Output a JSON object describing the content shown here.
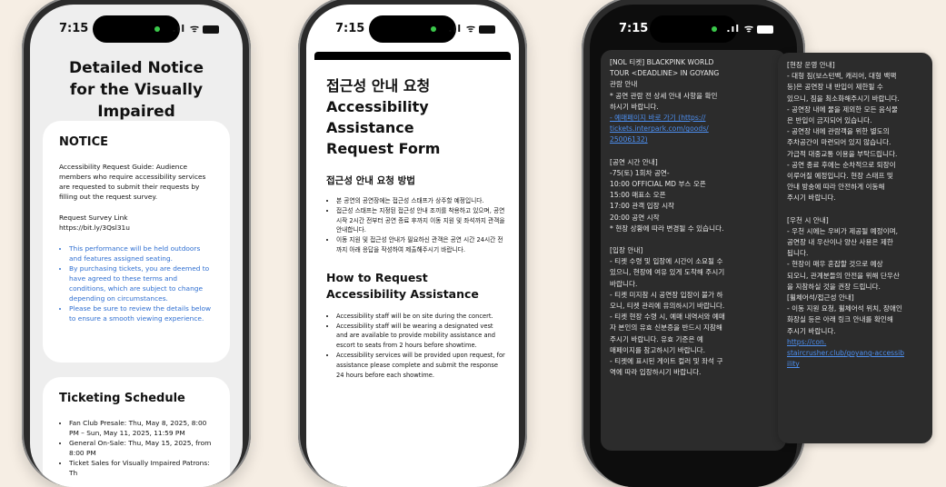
{
  "status": {
    "time": "7:15",
    "signal": ".ıl",
    "wifi": "ᯤ"
  },
  "phone1": {
    "title_line1": "Detailed Notice",
    "title_line2": "for the Visually Impaired",
    "notice": {
      "heading": "NOTICE",
      "body": "Accessibility Request Guide: Audience members who require accessibility services are requested to submit their requests by filling out the request survey.",
      "link_label": "Request Survey Link",
      "link_url": "https://bit.ly/3Qsl31u",
      "bullets": [
        "This performance will be held outdoors and features assigned seating.",
        "By purchasing tickets, you are deemed to have agreed to these terms and conditions, which are subject to change depending on circumstances.",
        "Please be sure to review the details below to ensure a smooth viewing experience."
      ]
    },
    "schedule": {
      "heading": "Ticketing Schedule",
      "bullets": [
        "Fan Club Presale: Thu, May 8, 2025, 8:00 PM – Sun, May 11, 2025, 11:59 PM",
        "General On-Sale: Thu, May 15, 2025, from 8:00 PM",
        "Ticket Sales for Visually Impaired Patrons: Th"
      ]
    }
  },
  "phone2": {
    "title_kr": "접근성 안내 요청",
    "title_en_1": "Accessibility Assistance",
    "title_en_2": "Request Form",
    "section_kr": "접근성 안내 요청 방법",
    "bullets_kr": [
      "본 공연의 공연장에는 접근성 스태프가 상주할 예정입니다.",
      "접근성 스태프는 지정된 접근성 안내 조끼를 착용하고 있으며, 공연 시작 2시간 전부터 공연 종료 후까지 이동 지원 및 좌석까지 관객을 안내합니다.",
      "이동 지원 및 접근성 안내가 필요하신 관객은 공연 시간 24시간 전까지 아래 응답을 작성하여 제출해주시기 바랍니다."
    ],
    "section_en_1": "How to Request",
    "section_en_2": "Accessibility Assistance",
    "bullets_en": [
      "Accessibility staff will be on site during the concert.",
      "Accessibility staff will be wearing a designated vest and are available to provide mobility assistance and escort to seats from 2 hours before showtime.",
      "Accessibility services will be provided upon request, for assistance please complete and submit the response 24 hours before each showtime."
    ]
  },
  "phone3": {
    "left_panel": [
      [
        "[NOL 티켓] BLACKPINK WORLD",
        "TOUR <DEADLINE> IN GOYANG",
        "관람 안내",
        "* 공연 관람 전 상세 안내 사항을 확인",
        "하시기 바랍니다.",
        "- 예매페이지 바로 가기 (https://",
        "tickets.interpark.com/goods/",
        "25006132)"
      ],
      [
        "[공연 시간 안내]",
        "-75(토) 1회차 공연-",
        "10:00 OFFICIAL MD 부스 오픈",
        "15:00 매표소 오픈",
        "17:00 관객 입장 시작",
        "20:00 공연 시작",
        "* 현장 상황에 따라 변경될 수 있습니다."
      ],
      [
        "[입장 안내]",
        "- 티켓 수령 및 입장에 시간이 소요될 수",
        "있으니, 현장에 여유 있게 도착해 주시기",
        "바랍니다.",
        "- 티켓 미지참 시 공연장 입장이 불가 하",
        "오니, 티켓 관리에 유의하시기 바랍니다.",
        "- 티켓 현장 수령 시, 예매 내역서와 예매",
        "자 본인의 유효 신분증을 반드시 지참해",
        "주시기 바랍니다. 유효 기준은 예",
        "매페이지를 참고하시기 바랍니다.",
        "- 티켓에 표시된 게이트 컬러 및 좌석 구",
        "역에 따라 입장하시기 바랍니다."
      ]
    ],
    "right_panel": [
      [
        "[현장 운영 안내]",
        "- 대형 짐(보스턴백, 캐리어, 대형 백팩",
        "등)은 공연장 내 반입이 제한될 수",
        "있으니, 짐을 최소화해주시기 바랍니다.",
        "- 공연장 내에 물을 제외한 모든 음식물",
        "은 반입이 금지되어 있습니다.",
        "- 공연장 내에 관람객을 위한 별도의",
        "주차공간이 마련되어 있지 않습니다.",
        "가급적 대중교통 이용을 부탁드립니다.",
        "- 공연 종료 후에는 순차적으로 퇴장이",
        "이루어질 예정입니다. 현장 스태프 및",
        "안내 방송에 따라 안전하게 이동해",
        "주시기 바랍니다."
      ],
      [
        "[우천 시 안내]",
        "- 우천 시에는 우비가 제공될 예정이며,",
        "공연장 내 우산이나 양산 사용은 제한",
        "됩니다.",
        "- 현장이 매우 혼잡할 것으로 예상",
        "되오니, 관계분들의 안전을 위해 단우산",
        "을 지참하실 것을 권장 드립니다.",
        "[휠체어석/접근성 안내]",
        "- 이동 지원 요청, 휠체어석 위치, 장애인",
        "화장실 등은 아래 링크 안내를 확인해",
        "주시기 바랍니다.",
        "https://con.",
        "staircrusher.club/goyang-accessib",
        "ility"
      ]
    ],
    "link_lines_left": [
      5,
      6,
      7
    ],
    "link_lines_right": [
      11,
      12,
      13
    ]
  },
  "colors": {
    "background": "#f6eee4",
    "link": "#4d8ff0",
    "notice_blue": "#2f6fd1"
  }
}
